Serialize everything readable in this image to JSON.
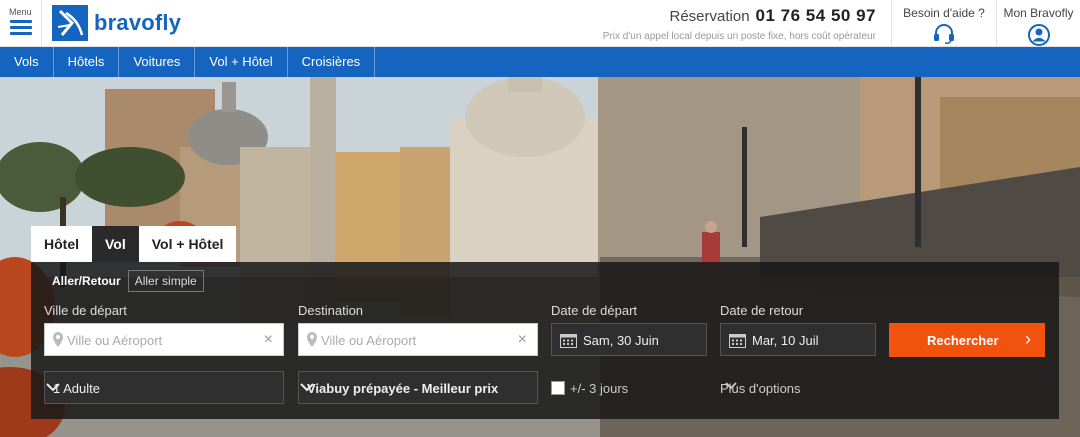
{
  "header": {
    "menu_label": "Menu",
    "brand": "bravofly",
    "reservation_label": "Réservation",
    "phone": "01 76 54 50 97",
    "phone_note": "Prix d'un appel local depuis un poste fixe, hors coût opérateur",
    "help_label": "Besoin d'aide ?",
    "account_label": "Mon Bravofly"
  },
  "nav": {
    "items": [
      "Vols",
      "Hôtels",
      "Voitures",
      "Vol + Hôtel",
      "Croisières"
    ]
  },
  "search": {
    "tabs": [
      "Hôtel",
      "Vol",
      "Vol + Hôtel"
    ],
    "active_tab": "Vol",
    "trip_types": [
      "Aller/Retour",
      "Aller simple"
    ],
    "active_trip_type": "Aller/Retour",
    "departure_label": "Ville de départ",
    "departure_placeholder": "Ville ou Aéroport",
    "destination_label": "Destination",
    "destination_placeholder": "Ville ou Aéroport",
    "depart_date_label": "Date de départ",
    "depart_date_value": "Sam, 30 Juin",
    "return_date_label": "Date de retour",
    "return_date_value": "Mar, 10 Juil",
    "search_button": "Rechercher",
    "passengers_value": "1 Adulte",
    "payment_value": "Viabuy prépayée - Meilleur prix",
    "flexible_label": "+/- 3 jours",
    "flexible_checked": false,
    "more_options": "Plus d'options"
  },
  "colors": {
    "brand_blue": "#1565c0",
    "search_orange": "#f1530f"
  },
  "icons": {
    "menu": "hamburger-icon",
    "help": "headset-icon",
    "account": "user-icon",
    "location": "pin-icon",
    "calendar": "calendar-icon",
    "clear": "close-icon",
    "dropdown": "chevron-down-icon",
    "submit": "chevron-right-icon"
  }
}
